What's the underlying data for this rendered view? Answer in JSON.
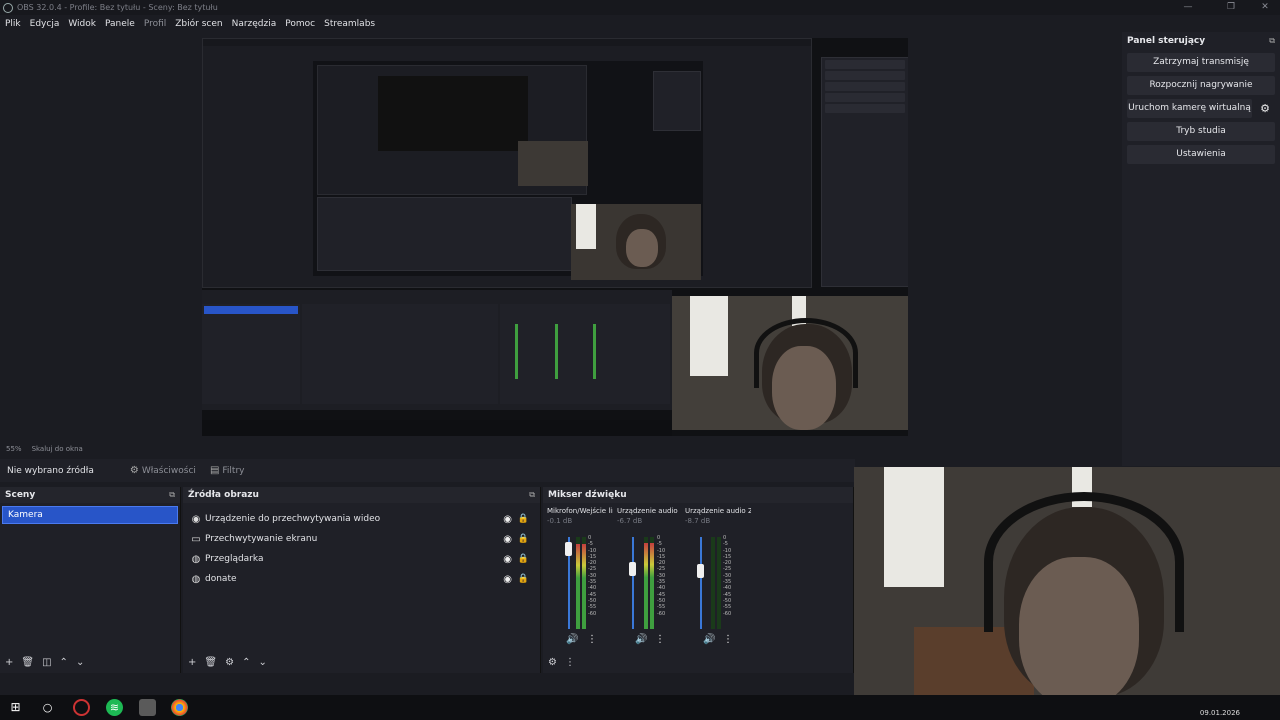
{
  "window": {
    "title": "OBS 32.0.4 - Profile: Bez tytułu - Sceny: Bez tytułu"
  },
  "menu": [
    "Plik",
    "Edycja",
    "Widok",
    "Panele",
    "Profil",
    "Zbiór scen",
    "Narzędzia",
    "Pomoc",
    "Streamlabs"
  ],
  "preview": {
    "zoom": "55%",
    "scale_mode": "Skaluj do okna"
  },
  "source_toolbar": {
    "no_source": "Nie wybrano źródła",
    "properties": "Właściwości",
    "filters": "Filtry"
  },
  "scenes": {
    "title": "Sceny",
    "items": [
      "Kamera"
    ]
  },
  "sources": {
    "title": "Źródła obrazu",
    "items": [
      {
        "name": "Urządzenie do przechwytywania wideo",
        "icon": "camera-icon"
      },
      {
        "name": "Przechwytywanie ekranu",
        "icon": "monitor-icon"
      },
      {
        "name": "Przeglądarka",
        "icon": "globe-icon"
      },
      {
        "name": "donate",
        "icon": "globe-icon"
      }
    ]
  },
  "mixer": {
    "title": "Mikser dźwięku",
    "channels": [
      {
        "name": "Mikrofon/Wejście lin",
        "db": "-0.1 dB",
        "fader": 0.93,
        "level": 0.92
      },
      {
        "name": "Urządzenie audio",
        "db": "-6.7 dB",
        "fader": 0.68,
        "level": 0.93
      },
      {
        "name": "Urządzenie audio 2",
        "db": "-8.7 dB",
        "fader": 0.66,
        "level": 0.0
      }
    ],
    "scale": [
      "0",
      "-5",
      "-10",
      "-15",
      "-20",
      "-25",
      "-30",
      "-35",
      "-40",
      "-45",
      "-50",
      "-55",
      "-60"
    ]
  },
  "controls": {
    "title": "Panel sterujący",
    "buttons": [
      "Zatrzymaj transmisję",
      "Rozpocznij nagrywanie",
      "Uruchom kamerę wirtualną",
      "Tryb studia",
      "Ustawienia"
    ]
  },
  "taskbar": {
    "date": "09.01.2026"
  }
}
